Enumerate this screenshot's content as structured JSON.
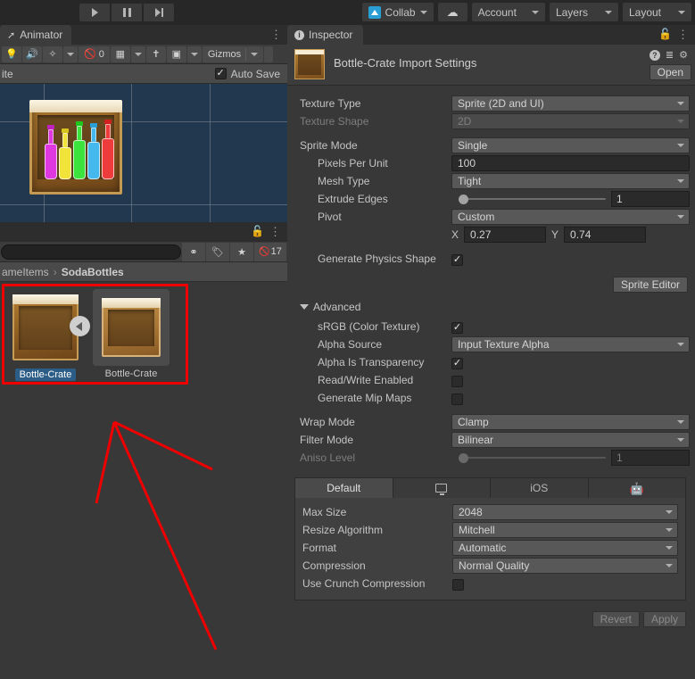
{
  "top_toolbar": {
    "play_icon": "play-icon",
    "pause_icon": "pause-icon",
    "step_icon": "step-icon",
    "collab_label": "Collab",
    "cloud_icon": "cloud-icon",
    "account_label": "Account",
    "layers_label": "Layers",
    "layout_label": "Layout"
  },
  "animator_panel": {
    "tab_label": "Animator",
    "tab_icon": "animator-icon",
    "scene_toolbar": {
      "lighting_icon": "lightbulb-icon",
      "audio_icon": "audio-icon",
      "fx_icon": "effects-icon",
      "hidden_icon": "eye-off-icon",
      "hidden_count": "0",
      "grid_icon": "grid-icon",
      "tools_icon": "wrench-icon",
      "camera_icon": "camera-icon",
      "gizmos_label": "Gizmos"
    },
    "state_label": "ite",
    "auto_save_label": "Auto Save",
    "auto_save_checked": true
  },
  "scene": {
    "background_color": "#22384f",
    "grid_color": "#7f8b96",
    "sprite_name": "bottle-crate-sprite",
    "bottles": [
      {
        "color": "#e038e0",
        "cap": "#c020c0",
        "height": 40
      },
      {
        "color": "#f2e33a",
        "cap": "#d8c420",
        "height": 36
      },
      {
        "color": "#3ce33c",
        "cap": "#1fc81f",
        "height": 44
      },
      {
        "color": "#45b8ee",
        "cap": "#2a9fd6",
        "height": 42
      },
      {
        "color": "#ee3b3b",
        "cap": "#d02020",
        "height": 46
      }
    ]
  },
  "project_panel": {
    "lock_icon": "lock-icon",
    "kebab_icon": "kebab-menu-icon",
    "search_placeholder": "",
    "search_value": "",
    "filters": {
      "type_icon": "type-filter-icon",
      "label_icon": "label-filter-icon",
      "favorite_icon": "star-icon",
      "hidden_icon": "eye-off-icon",
      "hidden_count": "17"
    },
    "breadcrumb": {
      "parent": "ameItems",
      "separator": "›",
      "current": "SodaBottles"
    },
    "assets": [
      {
        "name": "Bottle-Crate",
        "selected": true
      },
      {
        "name": "Bottle-Crate",
        "selected": false
      }
    ],
    "nav_arrow_icon": "chevron-left-icon",
    "annotation_color": "#ee0000"
  },
  "inspector": {
    "tab_label": "Inspector",
    "tab_icon": "info-icon",
    "lock_icon": "lock-icon",
    "kebab_icon": "kebab-menu-icon",
    "title": "Bottle-Crate Import Settings",
    "thumbnail_name": "bottle-crate-thumbnail",
    "help_icon": "help-icon",
    "preset_icon": "preset-icon",
    "gear_icon": "gear-icon",
    "open_label": "Open",
    "fields": {
      "texture_type_label": "Texture Type",
      "texture_type_value": "Sprite (2D and UI)",
      "texture_shape_label": "Texture Shape",
      "texture_shape_value": "2D",
      "sprite_mode_label": "Sprite Mode",
      "sprite_mode_value": "Single",
      "pixels_per_unit_label": "Pixels Per Unit",
      "pixels_per_unit_value": "100",
      "mesh_type_label": "Mesh Type",
      "mesh_type_value": "Tight",
      "extrude_edges_label": "Extrude Edges",
      "extrude_edges_value": "1",
      "pivot_label": "Pivot",
      "pivot_value": "Custom",
      "pivot_x_label": "X",
      "pivot_x_value": "0.27",
      "pivot_y_label": "Y",
      "pivot_y_value": "0.74",
      "generate_physics_shape_label": "Generate Physics Shape",
      "generate_physics_shape_checked": true,
      "sprite_editor_label": "Sprite Editor"
    },
    "advanced": {
      "section_label": "Advanced",
      "srgb_label": "sRGB (Color Texture)",
      "srgb_checked": true,
      "alpha_source_label": "Alpha Source",
      "alpha_source_value": "Input Texture Alpha",
      "alpha_is_transparency_label": "Alpha Is Transparency",
      "alpha_is_transparency_checked": true,
      "read_write_label": "Read/Write Enabled",
      "read_write_checked": false,
      "mipmaps_label": "Generate Mip Maps",
      "mipmaps_checked": false
    },
    "texture_settings": {
      "wrap_mode_label": "Wrap Mode",
      "wrap_mode_value": "Clamp",
      "filter_mode_label": "Filter Mode",
      "filter_mode_value": "Bilinear",
      "aniso_level_label": "Aniso Level",
      "aniso_level_value": "1"
    },
    "platform_tabs": [
      {
        "label": "Default",
        "icon": null,
        "active": true
      },
      {
        "label": "",
        "icon": "monitor-icon",
        "active": false
      },
      {
        "label": "iOS",
        "icon": null,
        "active": false
      },
      {
        "label": "",
        "icon": "android-icon",
        "active": false
      }
    ],
    "platform_settings": {
      "max_size_label": "Max Size",
      "max_size_value": "2048",
      "resize_algorithm_label": "Resize Algorithm",
      "resize_algorithm_value": "Mitchell",
      "format_label": "Format",
      "format_value": "Automatic",
      "compression_label": "Compression",
      "compression_value": "Normal Quality",
      "crunch_label": "Use Crunch Compression",
      "crunch_checked": false
    },
    "footer": {
      "revert_label": "Revert",
      "apply_label": "Apply"
    }
  }
}
